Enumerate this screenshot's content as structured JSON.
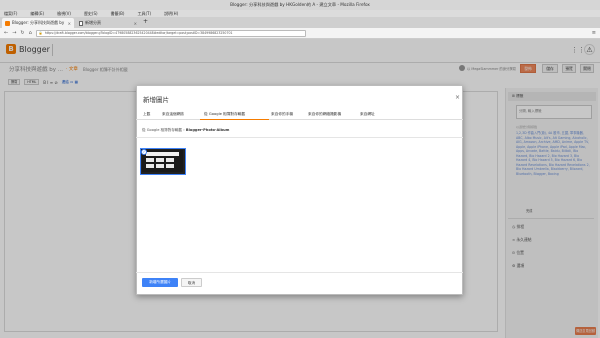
{
  "window": {
    "title": "Blogger: 分享科技與遊戲 by HKGolden的 A - 建立文章 - Mozilla Firefox"
  },
  "menubar": [
    "檔案(F)",
    "編輯(E)",
    "檢視(V)",
    "歷史(S)",
    "書籤(B)",
    "工具(T)",
    "說明(H)"
  ],
  "tabs": [
    {
      "label": "Blogger: 分享科技與遊戲 by",
      "icon": "blogger-icon"
    },
    {
      "label": "新增分頁",
      "icon": "document-icon"
    }
  ],
  "url": "https://draft.blogger.com/blogger.g?blogID=4798058823625420448#editor/target=post;postID=3849986823250701",
  "app": {
    "brand": "Blogger",
    "blog_name": "分享科技與遊戲 by ...",
    "post_state": "· 文章",
    "post_title": "Blogger 相簿不計外相載",
    "author": "以 MegaSlammmer 的身分撰寫",
    "buttons": {
      "publish": "發佈",
      "save": "儲存",
      "preview": "預覽",
      "close": "關閉"
    }
  },
  "editor_toolbar": {
    "compose": "撰寫",
    "html": "HTML",
    "icons": "B  I  ≡  ⊘",
    "link": "連結  ▭  ▦"
  },
  "sidebar": {
    "header": "標籤",
    "label_placeholder": "分隔, 輸入標籤",
    "label_hint": "以逗號分隔標籤",
    "labels_text": "1,2,3D 作曲入門(篇), 4A 股市, 五國, 軍事機器, ABC, Albo Music, Alt's, Alt Gaming, Alcoholic, AIG, Amazon, Archive, AMD, Anime, Apple TV, Apple, Apple iPhone, Apple iPad, Apple Mac, Apps, Arcade, Battle, Baidu, Bilibili, Bio Hazard, Bio Hazard 2, Bio Hazard 3, Bio Hazard 4, Bio Hazard 5, Bio Hazard 6, Bio Hazard Revelations, Bio Hazard Revelations 2, Bio Hazard Umbrella, Blackberry, Blizzard, Bluetooth, Blogger, Boxing",
    "done": "完成",
    "items": [
      "排程",
      "永久連結",
      "位置",
      "選項"
    ]
  },
  "feedback": "傳送意見回饋",
  "modal": {
    "title": "新增圖片",
    "tabs": [
      "上載",
      "來自這個網誌",
      "從 Google 相簿對存輸載",
      "來自你的手機",
      "來自你的網絡攝影機",
      "來自網址"
    ],
    "active_tab_index": 2,
    "breadcrumb_root": "從 Google 相簿對存輸載",
    "breadcrumb_sep": "›",
    "breadcrumb_album": "Blogger-Photo-Album",
    "add_button": "新增所選圖片",
    "cancel_button": "取消"
  }
}
